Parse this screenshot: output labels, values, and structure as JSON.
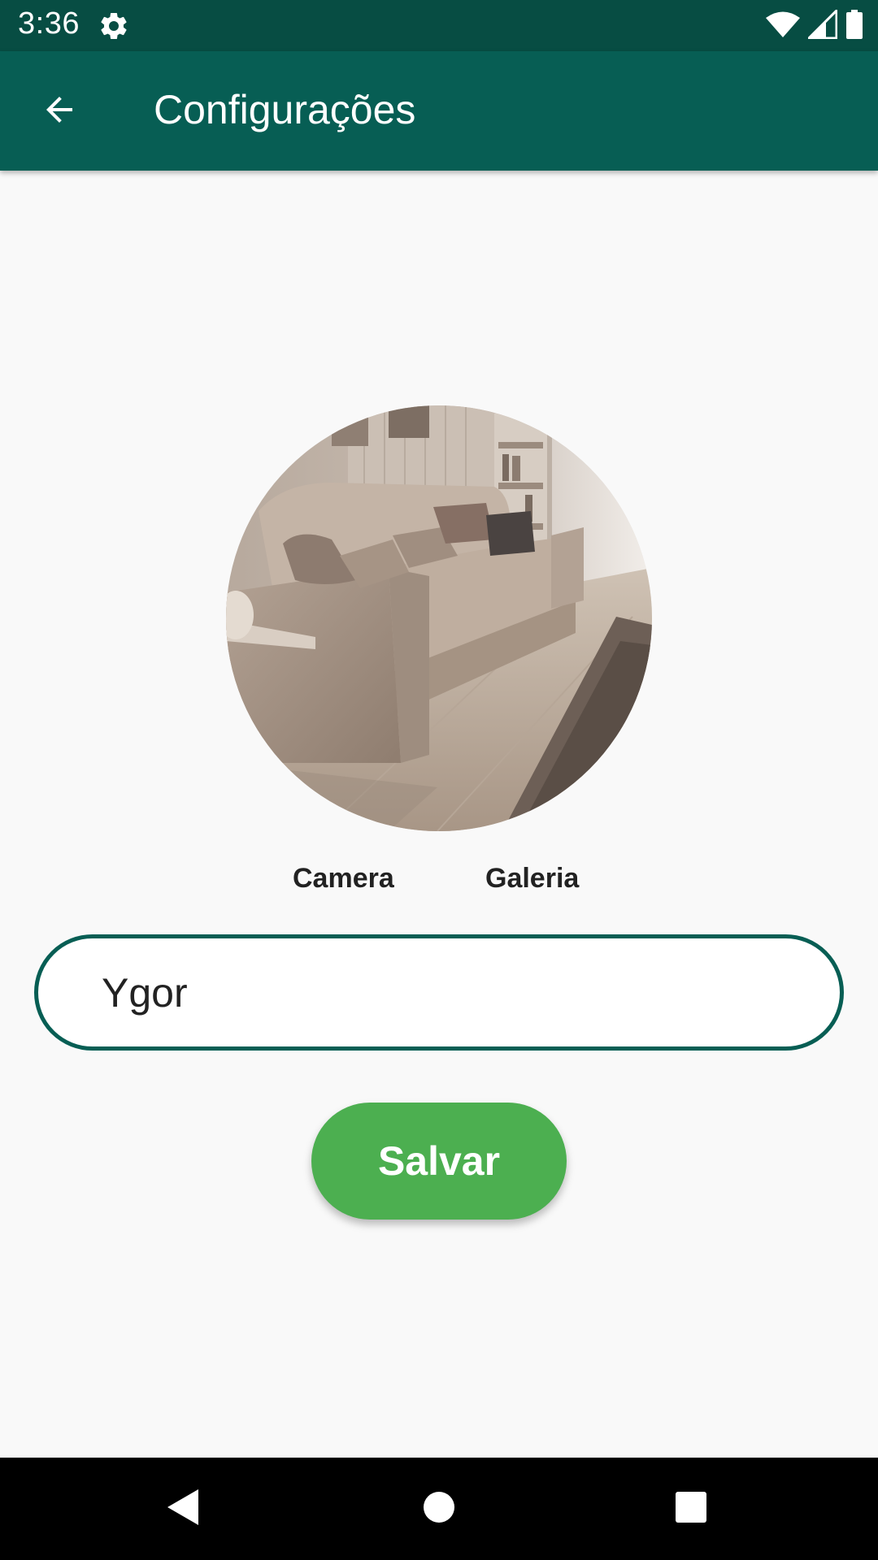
{
  "status_bar": {
    "time": "3:36",
    "icons": [
      "settings-gear-icon",
      "wifi-icon",
      "signal-icon",
      "battery-icon"
    ]
  },
  "app_bar": {
    "title": "Configurações",
    "back_icon": "arrow-back-icon",
    "background_color": "#075e54"
  },
  "profile": {
    "avatar_image": "living-room-sofa-photo",
    "camera_label": "Camera",
    "gallery_label": "Galeria",
    "name_value": "Ygor",
    "save_label": "Salvar",
    "save_color": "#4caf50"
  },
  "nav_bar": {
    "icons": [
      "nav-back-icon",
      "nav-home-icon",
      "nav-recent-icon"
    ]
  }
}
